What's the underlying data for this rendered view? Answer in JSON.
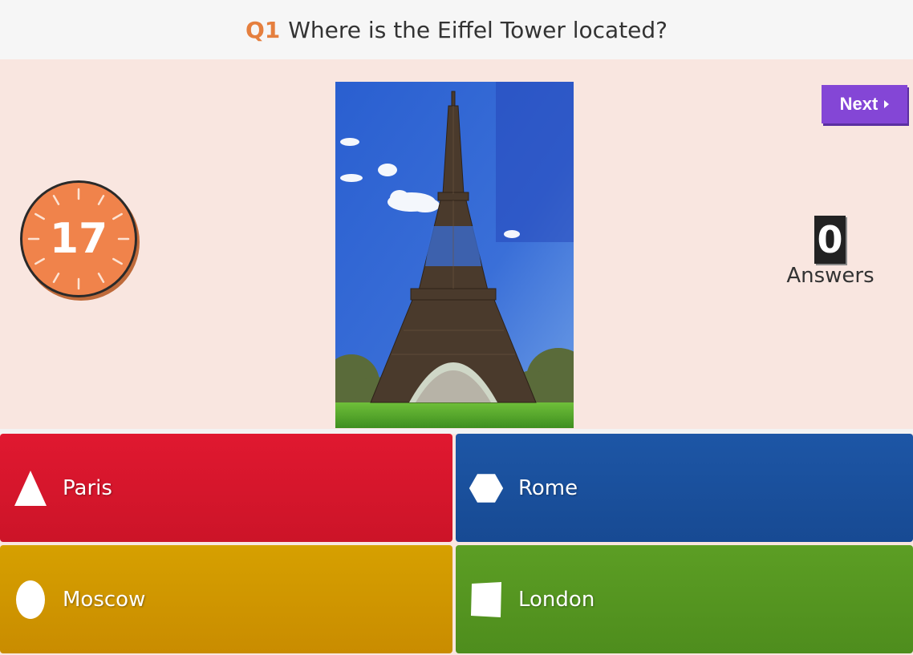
{
  "question": {
    "number": "Q1",
    "text": "Where is the Eiffel Tower located?"
  },
  "timer": {
    "seconds_left": "17"
  },
  "next_button": {
    "label": "Next"
  },
  "answers_counter": {
    "count": "0",
    "label": "Answers"
  },
  "choices": [
    {
      "label": "Paris",
      "shape": "triangle-icon",
      "color": "#d81b2f"
    },
    {
      "label": "Rome",
      "shape": "hexagon-icon",
      "color": "#1b52a0"
    },
    {
      "label": "Moscow",
      "shape": "circle-icon",
      "color": "#d29700"
    },
    {
      "label": "London",
      "shape": "square-icon",
      "color": "#57982a"
    }
  ],
  "colors": {
    "accent": "#e57f3e",
    "next_button": "#8446d6",
    "timer": "#f0834b",
    "background": "#f9e6e0"
  }
}
